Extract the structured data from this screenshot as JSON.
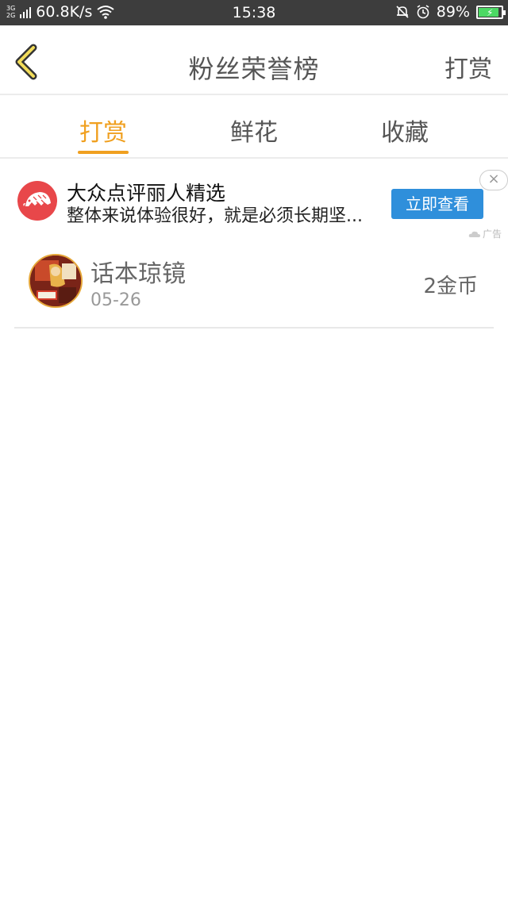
{
  "status_bar": {
    "network_top": "3G",
    "network_bottom": "2G",
    "speed": "60.8K/s",
    "time": "15:38",
    "battery": "89%"
  },
  "header": {
    "title": "粉丝荣誉榜",
    "action_label": "打赏"
  },
  "tabs": [
    {
      "label": "打赏",
      "active": true
    },
    {
      "label": "鲜花",
      "active": false
    },
    {
      "label": "收藏",
      "active": false
    }
  ],
  "ad": {
    "title": "大众点评丽人精选",
    "description": "整体来说体验很好，就是必须长期坚...",
    "button_label": "立即查看",
    "close_label": "×",
    "tag": "广告"
  },
  "list": [
    {
      "name": "话本琼镜",
      "date": "05-26",
      "amount": "2金币"
    }
  ],
  "colors": {
    "accent": "#f0a020",
    "ad_button": "#2f8fdb",
    "ad_logo": "#e8474a"
  }
}
